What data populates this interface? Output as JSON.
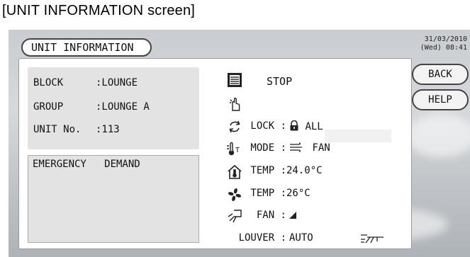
{
  "caption": "[UNIT INFORMATION screen]",
  "screen_title": "UNIT INFORMATION",
  "datetime": {
    "date": "31/03/2010",
    "time": "(Wed) 08:41"
  },
  "info": {
    "block_key": "BLOCK",
    "block_val": ":LOUNGE",
    "group_key": "GROUP",
    "group_val": ":LOUNGE A",
    "unit_key": "UNIT No.",
    "unit_val": ":113"
  },
  "emergency": "EMERGENCY   DEMAND",
  "status": "STOP",
  "rows": {
    "lock_label": "LOCK :",
    "lock_val": "ALL",
    "mode_label": "MODE :",
    "mode_val": "FAN",
    "settemp_label": "TEMP :",
    "settemp_val": "24.0°C",
    "roomtemp_label": "TEMP :",
    "roomtemp_val": "26°C",
    "fan_label": "FAN :",
    "louver_label": "LOUVER :",
    "louver_val": "AUTO"
  },
  "buttons": {
    "back": "BACK",
    "help": "HELP"
  },
  "icons": [
    "unit-icon",
    "hand-icon",
    "mode-cycle-icon",
    "thermometer-icon",
    "house-temp-icon",
    "fan-icon",
    "louver-icon",
    "lock-icon",
    "wind-lines-icon",
    "signal-bars-icon",
    "louver-auto-icon"
  ]
}
